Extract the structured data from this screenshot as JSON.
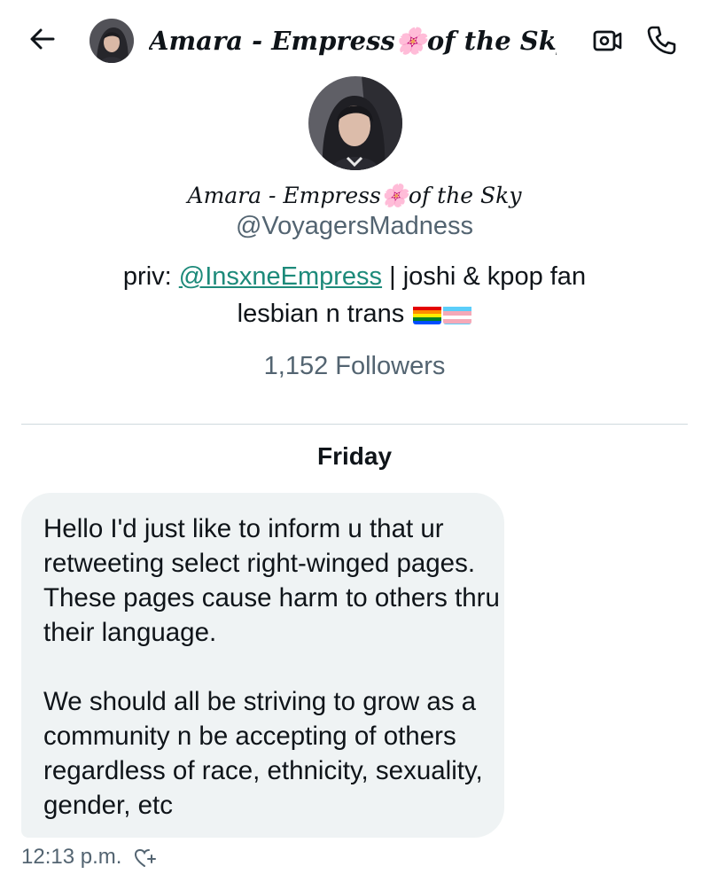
{
  "header": {
    "display_name": "Amara - Empress🌸of the Sky",
    "icons": {
      "back": "arrow-left-icon",
      "video": "video-call-icon",
      "call": "phone-icon"
    }
  },
  "profile": {
    "display_name": "Amara - Empress🌸of the Sky",
    "handle": "@VoyagersMadness",
    "bio_prefix": "priv: ",
    "bio_mention": "@InsxneEmpress",
    "bio_suffix": " | joshi & kpop fan",
    "bio_line2": "lesbian n trans",
    "flags": [
      "rainbow-flag",
      "transgender-flag"
    ],
    "followers": "1,152 Followers"
  },
  "conversation": {
    "day_label": "Friday",
    "messages": [
      {
        "text": "Hello I'd just like to inform u that ur retweeting select right-winged pages. These pages cause harm to others thru their language.\n\nWe should all be striving to grow as a community n be accepting of others regardless of race, ethnicity, sexuality, gender, etc",
        "timestamp": "12:13 p.m.",
        "reaction_icon": "add-reaction-icon"
      }
    ]
  },
  "colors": {
    "text": "#0f1419",
    "secondary_text": "#536471",
    "link": "#1d8a7a",
    "bubble_bg": "#eff3f4",
    "divider": "#cfd9de"
  }
}
